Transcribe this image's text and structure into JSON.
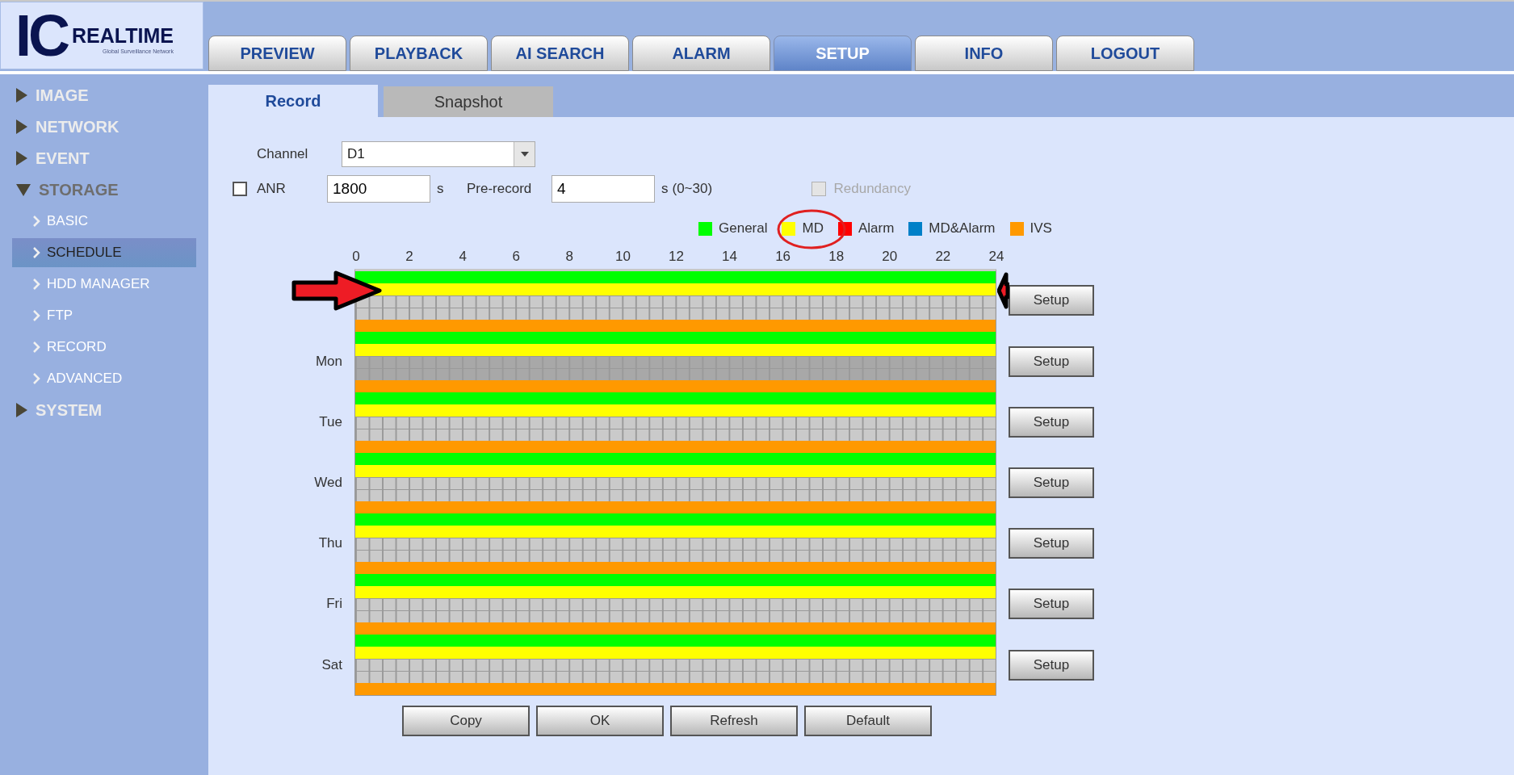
{
  "logo": {
    "letters": "IC",
    "name": "REALTIME",
    "tagline": "Global Surveillance Network"
  },
  "top_tabs": [
    {
      "label": "PREVIEW",
      "selected": false
    },
    {
      "label": "PLAYBACK",
      "selected": false
    },
    {
      "label": "AI SEARCH",
      "selected": false
    },
    {
      "label": "ALARM",
      "selected": false
    },
    {
      "label": "SETUP",
      "selected": true
    },
    {
      "label": "INFO",
      "selected": false
    },
    {
      "label": "LOGOUT",
      "selected": false
    }
  ],
  "sidebar": {
    "items": [
      {
        "label": "IMAGE",
        "expanded": false
      },
      {
        "label": "NETWORK",
        "expanded": false
      },
      {
        "label": "EVENT",
        "expanded": false
      },
      {
        "label": "STORAGE",
        "expanded": true,
        "children": [
          {
            "label": "BASIC",
            "selected": false
          },
          {
            "label": "SCHEDULE",
            "selected": true
          },
          {
            "label": "HDD MANAGER",
            "selected": false
          },
          {
            "label": "FTP",
            "selected": false
          },
          {
            "label": "RECORD",
            "selected": false
          },
          {
            "label": "ADVANCED",
            "selected": false
          }
        ]
      },
      {
        "label": "SYSTEM",
        "expanded": false
      }
    ]
  },
  "sub_tabs": [
    {
      "label": "Record",
      "selected": true
    },
    {
      "label": "Snapshot",
      "selected": false
    }
  ],
  "form": {
    "channel": {
      "label": "Channel",
      "value": "D1"
    },
    "anr": {
      "label": "ANR",
      "checked": false,
      "value": "1800",
      "unit": "s"
    },
    "pre_record": {
      "label": "Pre-record",
      "value": "4",
      "unit": "s",
      "range": "(0~30)"
    },
    "redundancy": {
      "label": "Redundancy",
      "checked": false,
      "disabled": true
    }
  },
  "legend": [
    {
      "label": "General",
      "color": "#00ff00"
    },
    {
      "label": "MD",
      "color": "#ffff00"
    },
    {
      "label": "Alarm",
      "color": "#ff0000"
    },
    {
      "label": "MD&Alarm",
      "color": "#0080c8"
    },
    {
      "label": "IVS",
      "color": "#ff9900"
    }
  ],
  "hours": [
    "0",
    "2",
    "4",
    "6",
    "8",
    "10",
    "12",
    "14",
    "16",
    "18",
    "20",
    "22",
    "24"
  ],
  "days": [
    {
      "selected": false,
      "tracks": [
        true,
        true,
        false,
        false,
        true
      ],
      "button": "Setup"
    },
    {
      "label": "Mon",
      "selected": true,
      "tracks": [
        true,
        true,
        false,
        false,
        true
      ],
      "button": "Setup"
    },
    {
      "label": "Tue",
      "selected": false,
      "tracks": [
        true,
        true,
        false,
        false,
        true
      ],
      "button": "Setup"
    },
    {
      "label": "Wed",
      "selected": false,
      "tracks": [
        true,
        true,
        false,
        false,
        true
      ],
      "button": "Setup"
    },
    {
      "label": "Thu",
      "selected": false,
      "tracks": [
        true,
        true,
        false,
        false,
        true
      ],
      "button": "Setup"
    },
    {
      "label": "Fri",
      "selected": false,
      "tracks": [
        true,
        true,
        false,
        false,
        true
      ],
      "button": "Setup"
    },
    {
      "label": "Sat",
      "selected": false,
      "tracks": [
        true,
        true,
        false,
        false,
        true
      ],
      "button": "Setup"
    }
  ],
  "buttons": [
    "Copy",
    "OK",
    "Refresh",
    "Default"
  ]
}
